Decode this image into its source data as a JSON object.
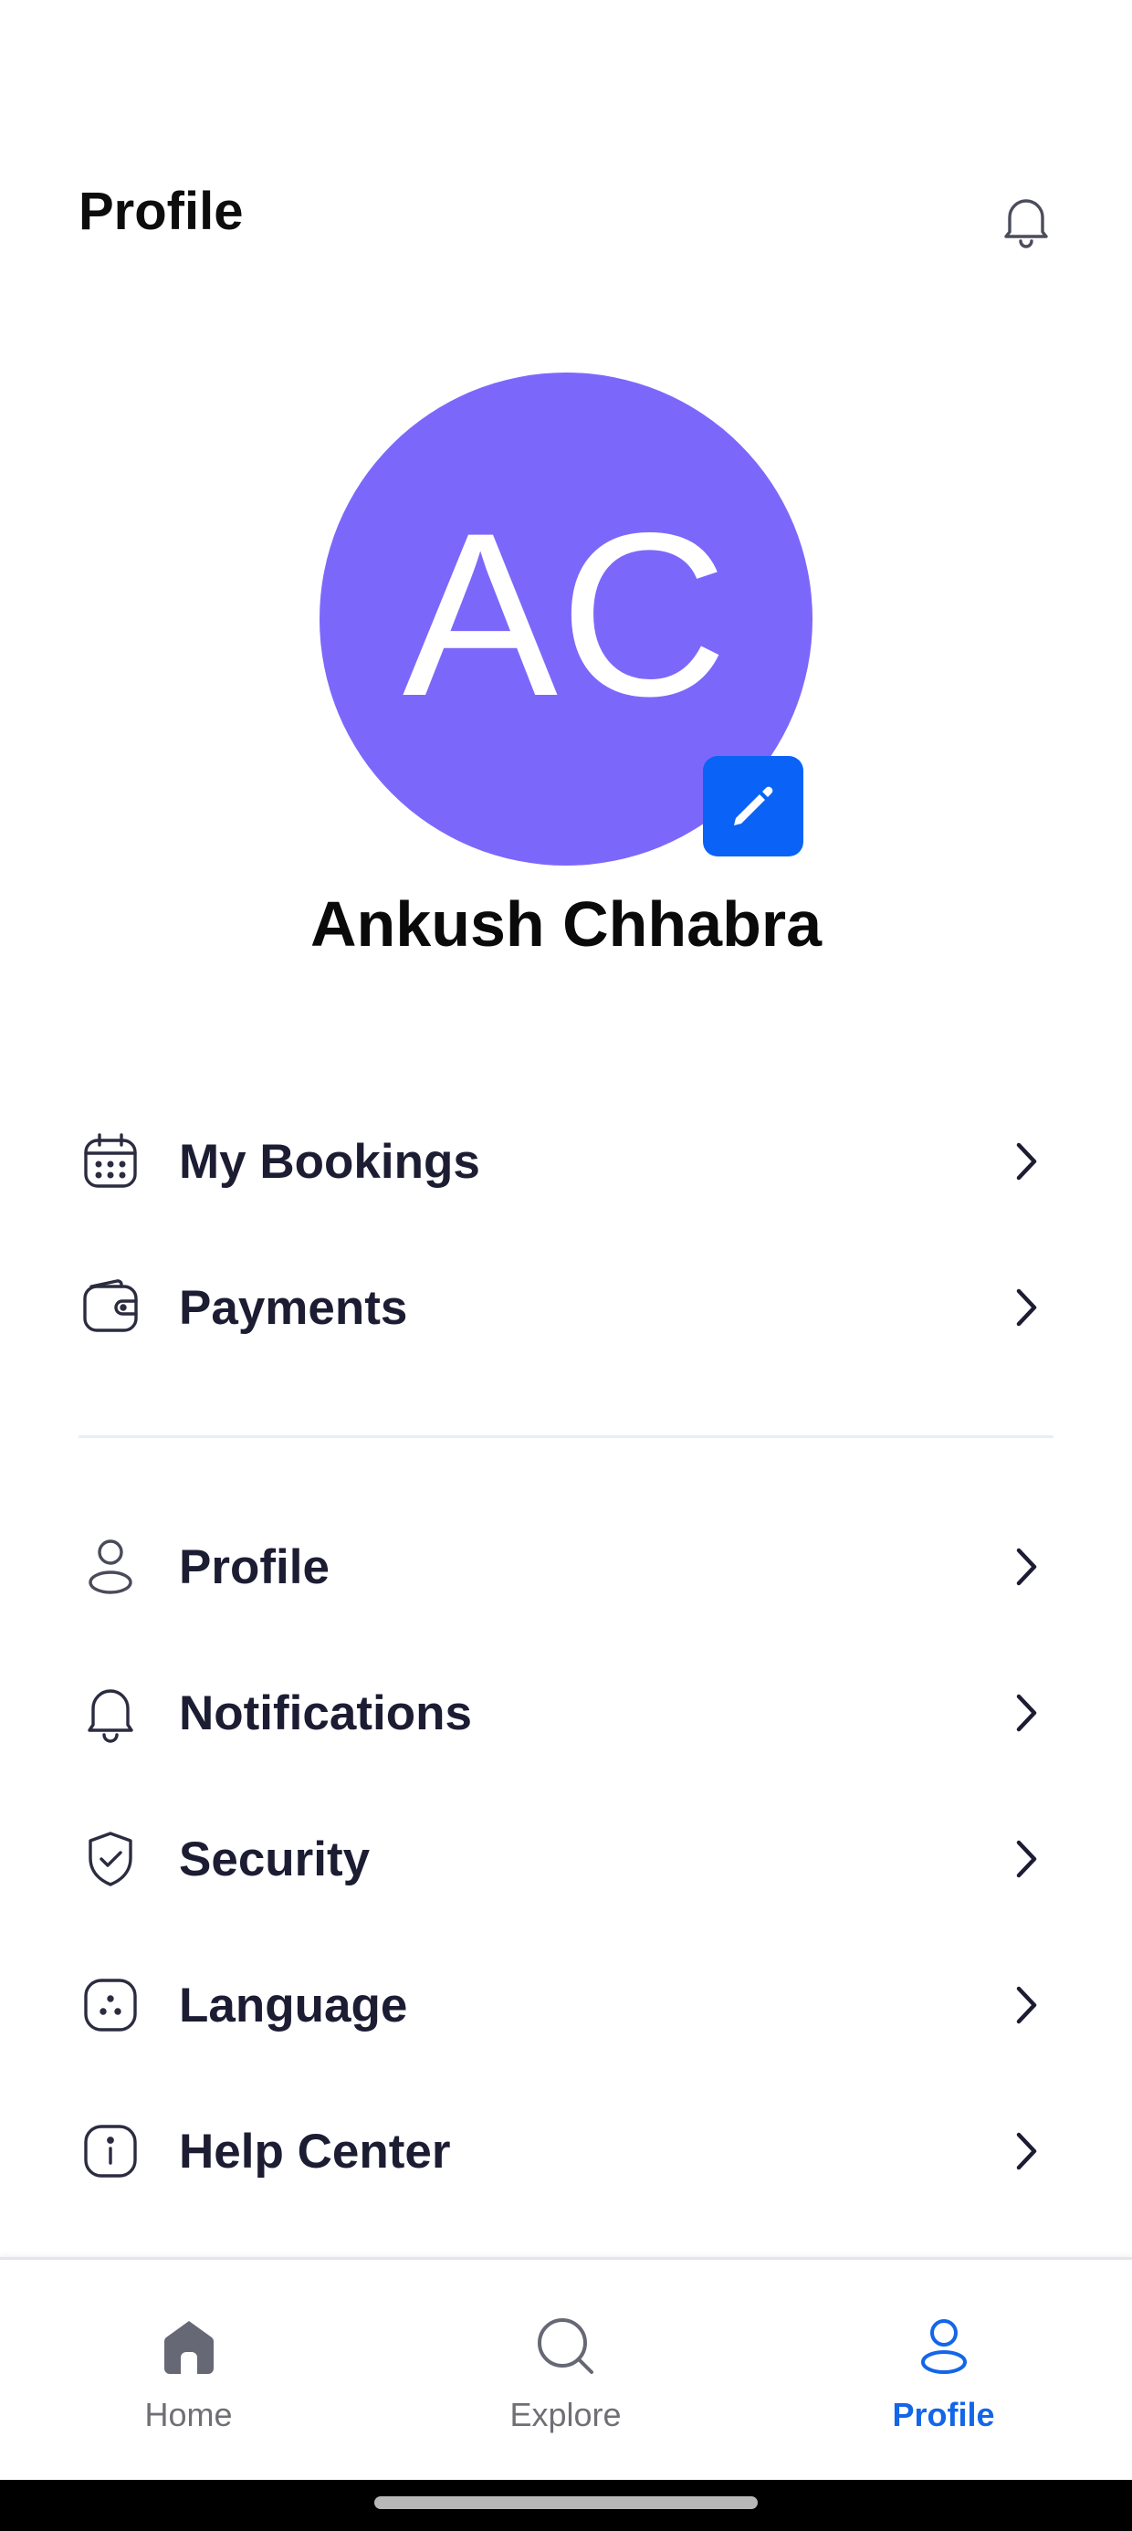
{
  "header": {
    "title": "Profile",
    "bell_icon": "bell-icon"
  },
  "user": {
    "initials": "AC",
    "name": "Ankush Chhabra",
    "avatar_color": "#7b68fb",
    "edit_color": "#0a63f6"
  },
  "menu_primary": [
    {
      "label": "My Bookings",
      "icon": "calendar-icon"
    },
    {
      "label": "Payments",
      "icon": "wallet-icon"
    }
  ],
  "menu_secondary": [
    {
      "label": "Profile",
      "icon": "user-icon"
    },
    {
      "label": "Notifications",
      "icon": "bell-icon"
    },
    {
      "label": "Security",
      "icon": "shield-check-icon"
    },
    {
      "label": "Language",
      "icon": "language-icon"
    },
    {
      "label": "Help Center",
      "icon": "info-icon"
    }
  ],
  "bottom_nav": {
    "items": [
      {
        "label": "Home",
        "icon": "home-icon",
        "active": false
      },
      {
        "label": "Explore",
        "icon": "search-icon",
        "active": false
      },
      {
        "label": "Profile",
        "icon": "user-icon",
        "active": true
      }
    ],
    "active_color": "#1366e8",
    "inactive_color": "#6f7075"
  },
  "colors": {
    "text_primary": "#1c1d33",
    "divider": "#e6eef7"
  }
}
